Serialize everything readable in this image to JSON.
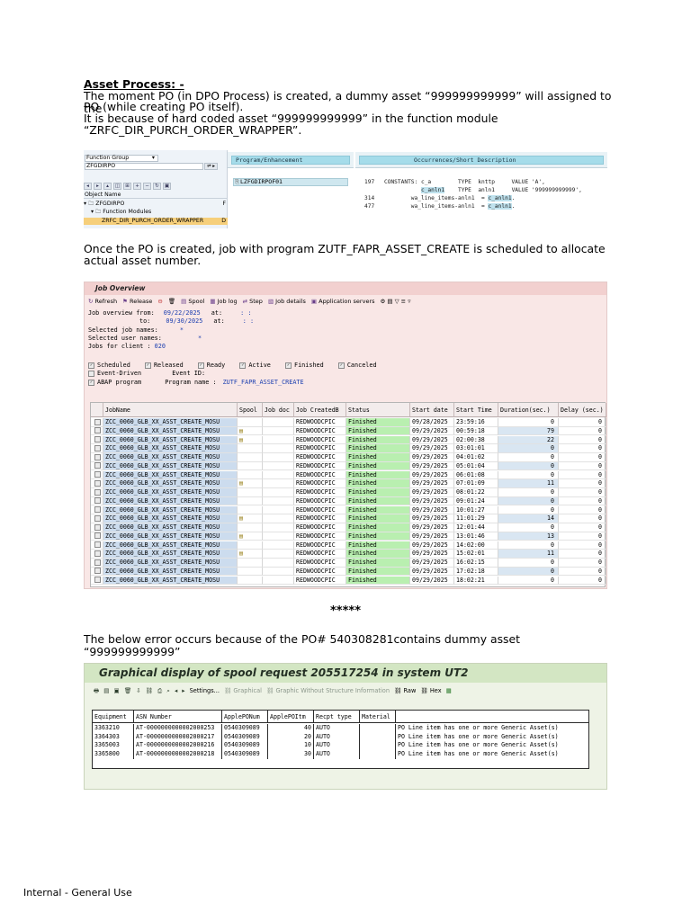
{
  "doc": {
    "heading": "Asset Process: -",
    "para1_lines": [
      "The moment PO (in DPO Process) is created, a dummy asset “999999999999” will assigned to the",
      "PO (while creating PO itself).",
      "It is because of hard coded asset “999999999999” in the function module",
      "“ZRFC_DIR_PURCH_ORDER_WRAPPER”."
    ],
    "para2_lines": [
      "Once the PO is created, job with program ZUTF_FAPR_ASSET_CREATE is scheduled to allocate",
      "actual asset number."
    ],
    "separator": "*****",
    "para3": "The below error occurs because of the PO# 540308281contains dummy asset “999999999999”",
    "footer": "Internal - General Use"
  },
  "shot1": {
    "function_group_label": "Function Group",
    "function_group_value": "ZFGDIRPO",
    "object_name_header": "Object Name",
    "tree": [
      "▾ 🗀 ZFGDIRPO",
      "▾ 🗀 Function Modules",
      "ZRFC_DIR_PURCH_ORDER_WRAPPER"
    ],
    "tree_cut": [
      "F",
      "D"
    ],
    "col1_header": "Program/Enhancement",
    "col2_header": "Occurrences/Short Description",
    "program_name": "LZFGDIRPOF01",
    "code_lines": [
      {
        "ln": "197",
        "text": "CONSTANTS: c_a        TYPE  knttp     VALUE 'A',"
      },
      {
        "ln": "",
        "text": "           c_anln1    TYPE  anln1     VALUE '999999999999',"
      },
      {
        "ln": "314",
        "text": "        wa_line_items-anln1  = c_anln1."
      },
      {
        "ln": "477",
        "text": "        wa_line_items-anln1  = c_anln1."
      }
    ]
  },
  "shot2": {
    "title": "Job Overview",
    "toolbar": [
      "Refresh",
      "Release",
      "Spool",
      "Job log",
      "Step",
      "Job details",
      "Application servers"
    ],
    "selection": {
      "from_label": "Job overview from:",
      "from_date": "09/22/2025",
      "to_label": "to:",
      "to_date": "09/30/2025",
      "at_label": "at:",
      "at_value": ":  :",
      "selected_job_names_label": "Selected       job names:",
      "selected_job_names_value": "*",
      "selected_user_names_label": "Selected user names:",
      "selected_user_names_value": "*",
      "client_label": "Jobs for client    :",
      "client_value": "020"
    },
    "statuses": [
      "Scheduled",
      "Released",
      "Ready",
      "Active",
      "Finished",
      "Canceled"
    ],
    "event_driven": "Event-Driven",
    "event_id_label": "Event ID:",
    "abap_program": "ABAP program",
    "program_name_label": "Program name :",
    "program_name": "ZUTF_FAPR_ASSET_CREATE",
    "columns": [
      "JobName",
      "Spool",
      "Job doc",
      "Job CreatedB",
      "Status",
      "Start date",
      "Start Time",
      "Duration(sec.)",
      "Delay (sec.)"
    ],
    "rows": [
      {
        "job": "ZCC_0060_GLB_XX_ASST_CREATE_MOSU",
        "spool": false,
        "created_by": "REDWOODCPIC",
        "status": "Finished",
        "date": "09/28/2025",
        "time": "23:59:16",
        "duration": "0",
        "delay": "0"
      },
      {
        "job": "ZCC_0060_GLB_XX_ASST_CREATE_MOSU",
        "spool": true,
        "created_by": "REDWOODCPIC",
        "status": "Finished",
        "date": "09/29/2025",
        "time": "00:59:18",
        "duration": "79",
        "delay": "0"
      },
      {
        "job": "ZCC_0060_GLB_XX_ASST_CREATE_MOSU",
        "spool": true,
        "created_by": "REDWOODCPIC",
        "status": "Finished",
        "date": "09/29/2025",
        "time": "02:00:38",
        "duration": "22",
        "delay": "0"
      },
      {
        "job": "ZCC_0060_GLB_XX_ASST_CREATE_MOSU",
        "spool": false,
        "created_by": "REDWOODCPIC",
        "status": "Finished",
        "date": "09/29/2025",
        "time": "03:01:01",
        "duration": "0",
        "delay": "0"
      },
      {
        "job": "ZCC_0060_GLB_XX_ASST_CREATE_MOSU",
        "spool": false,
        "created_by": "REDWOODCPIC",
        "status": "Finished",
        "date": "09/29/2025",
        "time": "04:01:02",
        "duration": "0",
        "delay": "0"
      },
      {
        "job": "ZCC_0060_GLB_XX_ASST_CREATE_MOSU",
        "spool": false,
        "created_by": "REDWOODCPIC",
        "status": "Finished",
        "date": "09/29/2025",
        "time": "05:01:04",
        "duration": "0",
        "delay": "0"
      },
      {
        "job": "ZCC_0060_GLB_XX_ASST_CREATE_MOSU",
        "spool": false,
        "created_by": "REDWOODCPIC",
        "status": "Finished",
        "date": "09/29/2025",
        "time": "06:01:08",
        "duration": "0",
        "delay": "0"
      },
      {
        "job": "ZCC_0060_GLB_XX_ASST_CREATE_MOSU",
        "spool": true,
        "created_by": "REDWOODCPIC",
        "status": "Finished",
        "date": "09/29/2025",
        "time": "07:01:09",
        "duration": "11",
        "delay": "0"
      },
      {
        "job": "ZCC_0060_GLB_XX_ASST_CREATE_MOSU",
        "spool": false,
        "created_by": "REDWOODCPIC",
        "status": "Finished",
        "date": "09/29/2025",
        "time": "08:01:22",
        "duration": "0",
        "delay": "0"
      },
      {
        "job": "ZCC_0060_GLB_XX_ASST_CREATE_MOSU",
        "spool": false,
        "created_by": "REDWOODCPIC",
        "status": "Finished",
        "date": "09/29/2025",
        "time": "09:01:24",
        "duration": "0",
        "delay": "0"
      },
      {
        "job": "ZCC_0060_GLB_XX_ASST_CREATE_MOSU",
        "spool": false,
        "created_by": "REDWOODCPIC",
        "status": "Finished",
        "date": "09/29/2025",
        "time": "10:01:27",
        "duration": "0",
        "delay": "0"
      },
      {
        "job": "ZCC_0060_GLB_XX_ASST_CREATE_MOSU",
        "spool": true,
        "created_by": "REDWOODCPIC",
        "status": "Finished",
        "date": "09/29/2025",
        "time": "11:01:29",
        "duration": "14",
        "delay": "0"
      },
      {
        "job": "ZCC_0060_GLB_XX_ASST_CREATE_MOSU",
        "spool": false,
        "created_by": "REDWOODCPIC",
        "status": "Finished",
        "date": "09/29/2025",
        "time": "12:01:44",
        "duration": "0",
        "delay": "0"
      },
      {
        "job": "ZCC_0060_GLB_XX_ASST_CREATE_MOSU",
        "spool": true,
        "created_by": "REDWOODCPIC",
        "status": "Finished",
        "date": "09/29/2025",
        "time": "13:01:46",
        "duration": "13",
        "delay": "0"
      },
      {
        "job": "ZCC_0060_GLB_XX_ASST_CREATE_MOSU",
        "spool": false,
        "created_by": "REDWOODCPIC",
        "status": "Finished",
        "date": "09/29/2025",
        "time": "14:02:00",
        "duration": "0",
        "delay": "0"
      },
      {
        "job": "ZCC_0060_GLB_XX_ASST_CREATE_MOSU",
        "spool": true,
        "created_by": "REDWOODCPIC",
        "status": "Finished",
        "date": "09/29/2025",
        "time": "15:02:01",
        "duration": "11",
        "delay": "0"
      },
      {
        "job": "ZCC_0060_GLB_XX_ASST_CREATE_MOSU",
        "spool": false,
        "created_by": "REDWOODCPIC",
        "status": "Finished",
        "date": "09/29/2025",
        "time": "16:02:15",
        "duration": "0",
        "delay": "0"
      },
      {
        "job": "ZCC_0060_GLB_XX_ASST_CREATE_MOSU",
        "spool": false,
        "created_by": "REDWOODCPIC",
        "status": "Finished",
        "date": "09/29/2025",
        "time": "17:02:18",
        "duration": "0",
        "delay": "0"
      },
      {
        "job": "ZCC_0060_GLB_XX_ASST_CREATE_MOSU",
        "spool": false,
        "created_by": "REDWOODCPIC",
        "status": "Finished",
        "date": "09/29/2025",
        "time": "18:02:21",
        "duration": "0",
        "delay": "0"
      }
    ]
  },
  "shot3": {
    "title": "Graphical display of spool request 205517254 in system UT2",
    "toolbar": [
      "Settings...",
      "Graphical",
      "Graphic Without Structure Information",
      "Raw",
      "Hex"
    ],
    "columns": [
      "Equipment",
      "ASN Number",
      "ApplePONum",
      "ApplePOItm",
      "Recpt type",
      "Material",
      ""
    ],
    "rows": [
      {
        "equipment": "3363210",
        "asn": "AT-0000000000002000253",
        "po": "0540309089",
        "item": "40",
        "type": "AUTO",
        "material": "",
        "message": "PO Line item has one or more Generic Asset(s)"
      },
      {
        "equipment": "3364303",
        "asn": "AT-0000000000002000217",
        "po": "0540309089",
        "item": "20",
        "type": "AUTO",
        "material": "",
        "message": "PO Line item has one or more Generic Asset(s)"
      },
      {
        "equipment": "3365003",
        "asn": "AT-0000000000002000216",
        "po": "0540309089",
        "item": "10",
        "type": "AUTO",
        "material": "",
        "message": "PO Line item has one or more Generic Asset(s)"
      },
      {
        "equipment": "3365800",
        "asn": "AT-0000000000002000218",
        "po": "0540309089",
        "item": "30",
        "type": "AUTO",
        "material": "",
        "message": "PO Line item has one or more Generic Asset(s)"
      }
    ]
  }
}
